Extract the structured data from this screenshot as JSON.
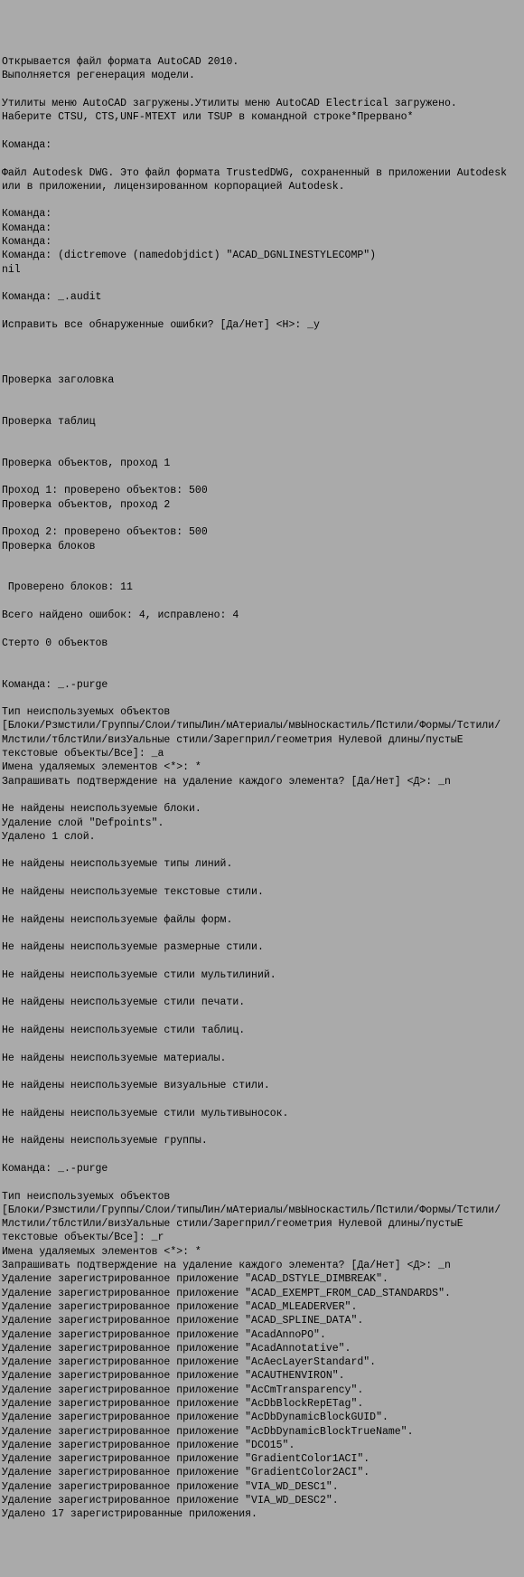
{
  "lines": [
    "Открывается файл формата AutoCAD 2010.",
    "Выполняется регенерация модели.",
    "",
    "Утилиты меню AutoCAD загружены.Утилиты меню AutoCAD Electrical загружено.",
    "Наберите CTSU, CTS,UNF-MTEXT или TSUP в командной строке*Прервано*",
    "",
    "Команда:",
    "",
    "Файл Autodesk DWG. Это файл формата TrustedDWG, сохраненный в приложении Autodesk или в приложении, лицензированном корпорацией Autodesk.",
    "",
    "Команда:",
    "Команда:",
    "Команда:",
    "Команда: (dictremove (namedobjdict) \"ACAD_DGNLINESTYLECOMP\")",
    "nil",
    "",
    "Команда: _.audit",
    "",
    "Исправить все обнаруженные ошибки? [Да/Нет] <Н>: _y",
    "",
    "",
    "",
    "Проверка заголовка",
    "",
    "",
    "Проверка таблиц",
    "",
    "",
    "Проверка объектов, проход 1",
    "",
    "Проход 1: проверено объектов: 500",
    "Проверка объектов, проход 2",
    "",
    "Проход 2: проверено объектов: 500",
    "Проверка блоков",
    "",
    "",
    " Проверено блоков: 11",
    "",
    "Всего найдено ошибок: 4, исправлено: 4",
    "",
    "Стерто 0 объектов",
    "",
    "",
    "Команда: _.-purge",
    "",
    "Тип неиспользуемых объектов",
    "[Блоки/Рзмстили/Группы/Слои/типыЛин/мАтериалы/мвЫноскастиль/Пстили/Формы/Тстили/Млстили/тблстИли/визУальные стили/Зарегприл/геометрия Нулевой длины/пустыЕ текстовые объекты/Все]: _a",
    "Имена удаляемых элементов <*>: *",
    "Запрашивать подтверждение на удаление каждого элемента? [Да/Нет] <Д>: _n",
    "",
    "Не найдены неиспользуемые блоки.",
    "Удаление слой \"Defpoints\".",
    "Удалено 1 слой.",
    "",
    "Не найдены неиспользуемые типы линий.",
    "",
    "Не найдены неиспользуемые текстовые стили.",
    "",
    "Не найдены неиспользуемые файлы форм.",
    "",
    "Не найдены неиспользуемые размерные стили.",
    "",
    "Не найдены неиспользуемые стили мультилиний.",
    "",
    "Не найдены неиспользуемые стили печати.",
    "",
    "Не найдены неиспользуемые стили таблиц.",
    "",
    "Не найдены неиспользуемые материалы.",
    "",
    "Не найдены неиспользуемые визуальные стили.",
    "",
    "Не найдены неиспользуемые стили мультивыносок.",
    "",
    "Не найдены неиспользуемые группы.",
    "",
    "Команда: _.-purge",
    "",
    "Тип неиспользуемых объектов",
    "[Блоки/Рзмстили/Группы/Слои/типыЛин/мАтериалы/мвЫноскастиль/Пстили/Формы/Тстили/Млстили/тблстИли/визУальные стили/Зарегприл/геометрия Нулевой длины/пустыЕ текстовые объекты/Все]: _r",
    "Имена удаляемых элементов <*>: *",
    "Запрашивать подтверждение на удаление каждого элемента? [Да/Нет] <Д>: _n",
    "Удаление зарегистрированное приложение \"ACAD_DSTYLE_DIMBREAK\".",
    "Удаление зарегистрированное приложение \"ACAD_EXEMPT_FROM_CAD_STANDARDS\".",
    "Удаление зарегистрированное приложение \"ACAD_MLEADERVER\".",
    "Удаление зарегистрированное приложение \"ACAD_SPLINE_DATA\".",
    "Удаление зарегистрированное приложение \"AcadAnnoPO\".",
    "Удаление зарегистрированное приложение \"AcadAnnotative\".",
    "Удаление зарегистрированное приложение \"AcAecLayerStandard\".",
    "Удаление зарегистрированное приложение \"ACAUTHENVIRON\".",
    "Удаление зарегистрированное приложение \"AcCmTransparency\".",
    "Удаление зарегистрированное приложение \"AcDbBlockRepETag\".",
    "Удаление зарегистрированное приложение \"AcDbDynamicBlockGUID\".",
    "Удаление зарегистрированное приложение \"AcDbDynamicBlockTrueName\".",
    "Удаление зарегистрированное приложение \"DCO15\".",
    "Удаление зарегистрированное приложение \"GradientColor1ACI\".",
    "Удаление зарегистрированное приложение \"GradientColor2ACI\".",
    "Удаление зарегистрированное приложение \"VIA_WD_DESC1\".",
    "Удаление зарегистрированное приложение \"VIA_WD_DESC2\".",
    "Удалено 17 зарегистрированные приложения."
  ]
}
